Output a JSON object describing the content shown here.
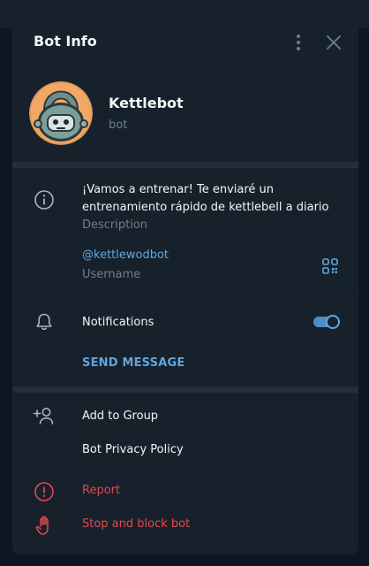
{
  "header": {
    "title": "Bot Info"
  },
  "profile": {
    "name": "Kettlebot",
    "subtitle": "bot"
  },
  "info": {
    "description": "¡Vamos a entrenar! Te enviaré un entrenamiento rápido de kettlebell a diario",
    "description_label": "Description",
    "username": "@kettlewodbot",
    "username_label": "Username"
  },
  "notifications": {
    "label": "Notifications",
    "enabled": true
  },
  "actions": {
    "send_message": "SEND MESSAGE",
    "add_to_group": "Add to Group",
    "privacy_policy": "Bot Privacy Policy",
    "report": "Report",
    "stop_block": "Stop and block bot"
  },
  "colors": {
    "accent": "#62a7e3",
    "danger": "#e5474c",
    "panel": "#17212b",
    "text": "#f5f5f5",
    "muted": "#6d7f8f"
  }
}
